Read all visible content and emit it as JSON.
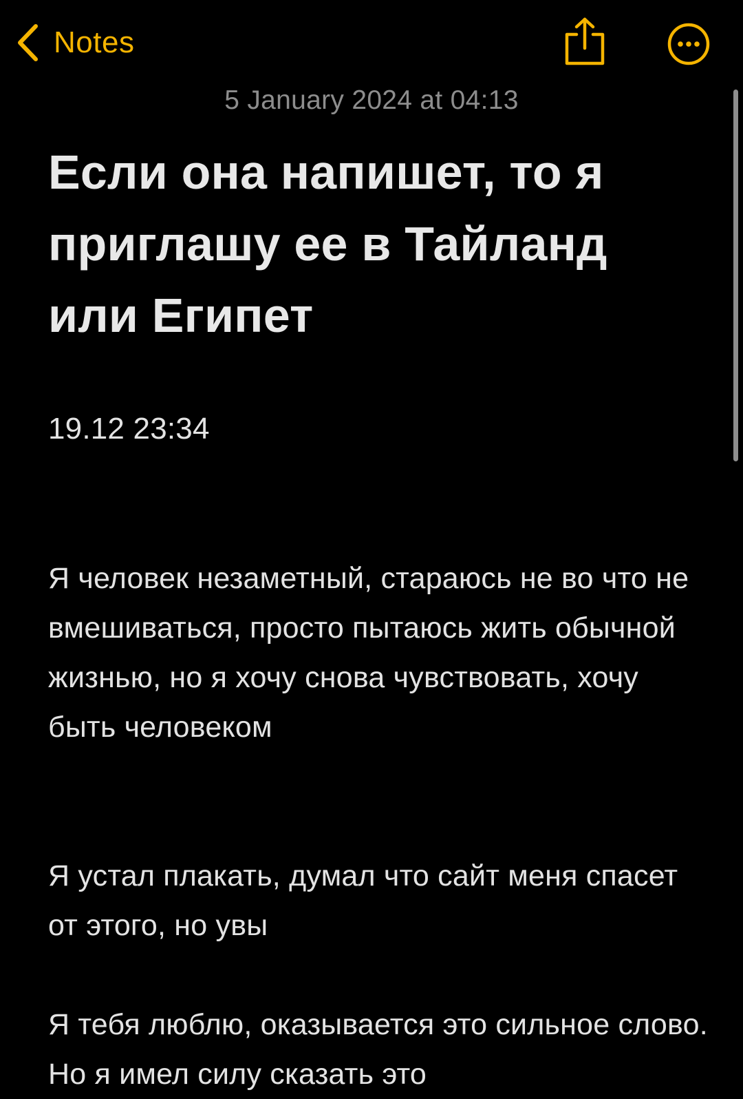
{
  "nav": {
    "back_label": "Notes",
    "share_icon": "share-icon",
    "more_icon": "more-icon",
    "back_icon": "chevron-left-icon"
  },
  "note": {
    "date": "5 January 2024 at 04:13",
    "title": "Если она напишет, то я приглашу ее в Тайланд или Египет",
    "time": "19.12 23:34",
    "paragraphs": [
      "Я человек незаметный, стараюсь не во что не вмешиваться, просто пытаюсь жить обычной жизнью, но я хочу снова чувствовать, хочу быть человеком",
      "Я устал плакать, думал что сайт меня спасет от этого, но увы",
      "Я тебя люблю, оказывается это сильное слово. Но я имел силу сказать это"
    ]
  },
  "colors": {
    "accent": "#f5b400",
    "background": "#000000",
    "text": "#e6e6e6",
    "secondary_text": "#8d8d8d"
  }
}
